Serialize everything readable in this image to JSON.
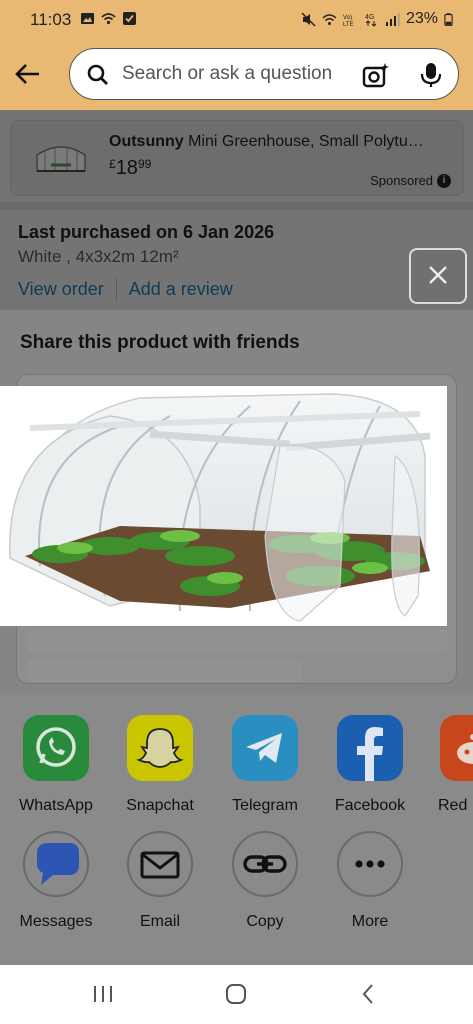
{
  "status_bar": {
    "time": "11:03",
    "battery": "23%"
  },
  "search": {
    "placeholder": "Search or ask a question"
  },
  "sponsored_product": {
    "brand": "Outsunny",
    "title_rest": " Mini Greenhouse, Small Polytu…",
    "currency": "£",
    "price_main": "18",
    "price_cents": "99",
    "sponsored_label": "Sponsored",
    "info_icon": "i"
  },
  "purchase": {
    "last_purchased": "Last purchased on 6 Jan 2026",
    "variant": "White , 4x3x2m 12m²",
    "view_order": "View order",
    "add_review": "Add a review"
  },
  "share_sheet": {
    "title": "Share this product with friends"
  },
  "apps": [
    {
      "label": "WhatsApp",
      "color": "#2a8a3c"
    },
    {
      "label": "Snapchat",
      "color": "#c9c600"
    },
    {
      "label": "Telegram",
      "color": "#2b8ec0"
    },
    {
      "label": "Facebook",
      "color": "#1a5fb0"
    },
    {
      "label": "Red",
      "color": "#c8461c"
    },
    {
      "label": "Messages",
      "color": "#2c55b4"
    },
    {
      "label": "Email",
      "color": "#8a8a8a"
    },
    {
      "label": "Copy",
      "color": "#8a8a8a"
    },
    {
      "label": "More",
      "color": "#8a8a8a"
    }
  ]
}
